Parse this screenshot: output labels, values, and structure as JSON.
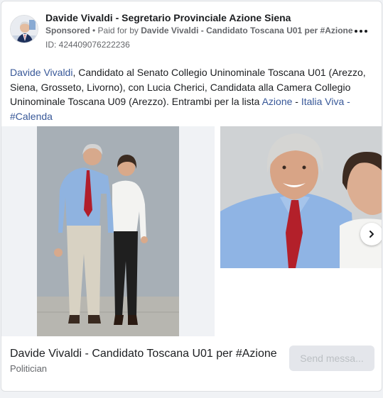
{
  "header": {
    "page_name": "Davide Vivaldi - Segretario Provinciale Azione Siena",
    "sponsored_label": "Sponsored",
    "separator": " • ",
    "paid_for_prefix": "Paid for by ",
    "paid_for_by": "Davide Vivaldi - Candidato Toscana U01 per #Azione",
    "ad_id": "ID: 424409076222236",
    "more_icon": "more-horizontal-icon"
  },
  "body": {
    "name_link": "Davide Vivaldi",
    "text_1": ", Candidato al Senato Collegio Uninominale Toscana U01 (Arezzo, Siena, Grosseto, Livorno), con Lucia Cherici, Candidata alla Camera Collegio Uninominale Toscana U09 (Arezzo). Entrambi per la lista ",
    "link_azione": "Azione",
    "sep_1": " - ",
    "link_italia_viva": "Italia Viva",
    "sep_2": " - ",
    "hashtag": "#Calenda"
  },
  "carousel": {
    "next_icon": "chevron-right-icon"
  },
  "footer": {
    "title": "Davide Vivaldi - Candidato Toscana U01 per #Azione",
    "subtitle": "Politician",
    "button_label": "Send messa..."
  },
  "colors": {
    "link": "#385898",
    "text": "#1c1e21",
    "secondary": "#65676b",
    "button_bg": "#e4e6eb"
  }
}
